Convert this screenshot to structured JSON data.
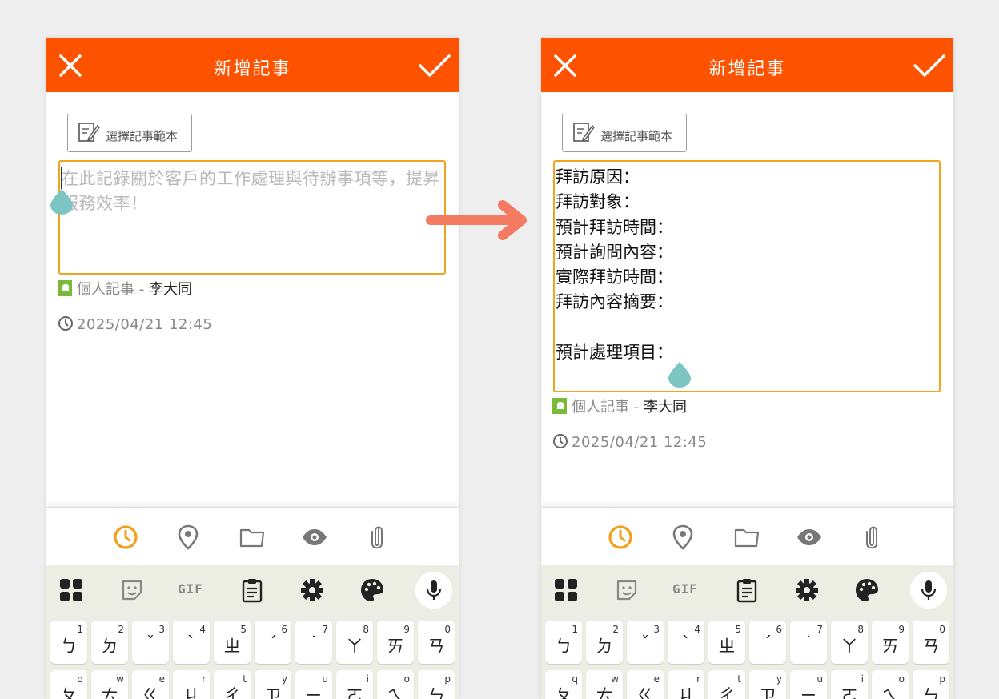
{
  "app": {
    "title": "新增記事",
    "template_button_label": "選擇記事範本",
    "owner_label": "個人記事 - ",
    "owner_name": "李大同",
    "timestamp": "2025/04/21 12:45",
    "accent_color": "#fd5200",
    "editor_border_color": "#f1a420"
  },
  "left": {
    "placeholder": "在此記錄關於客戶的工作處理與待辦事項等，提昇服務效率！"
  },
  "right": {
    "lines": [
      "拜訪原因：",
      "拜訪對象：",
      "預計拜訪時間：",
      "預計詢問內容：",
      "實際拜訪時間：",
      "拜訪內容摘要：",
      "",
      "預計處理項目："
    ]
  },
  "toolbar_icons": [
    "clock-icon",
    "location-pin-icon",
    "folder-icon",
    "eye-icon",
    "paperclip-icon"
  ],
  "keyboard": {
    "top_row": [
      "apps-grid-icon",
      "sticker-icon",
      "GIF",
      "clipboard-icon",
      "gear-icon",
      "palette-icon",
      "microphone-icon"
    ],
    "gif_label": "GIF",
    "row1": [
      {
        "main": "ㄅ",
        "sub": "1"
      },
      {
        "main": "ㄉ",
        "sub": "2"
      },
      {
        "main": "ˇ",
        "sub": "3"
      },
      {
        "main": "ˋ",
        "sub": "4"
      },
      {
        "main": "ㄓ",
        "sub": "5"
      },
      {
        "main": "ˊ",
        "sub": "6"
      },
      {
        "main": "˙",
        "sub": "7"
      },
      {
        "main": "ㄚ",
        "sub": "8"
      },
      {
        "main": "ㄞ",
        "sub": "9"
      },
      {
        "main": "ㄢ",
        "sub": "0"
      }
    ],
    "row2": [
      {
        "main": "ㄆ",
        "sub": "q"
      },
      {
        "main": "ㄊ",
        "sub": "w"
      },
      {
        "main": "ㄍ",
        "sub": "e"
      },
      {
        "main": "ㄐ",
        "sub": "r"
      },
      {
        "main": "ㄔ",
        "sub": "t"
      },
      {
        "main": "ㄗ",
        "sub": "y"
      },
      {
        "main": "ㄧ",
        "sub": "u"
      },
      {
        "main": "ㄛ",
        "sub": "i"
      },
      {
        "main": "ㄟ",
        "sub": "o"
      },
      {
        "main": "ㄣ",
        "sub": "p"
      }
    ]
  }
}
